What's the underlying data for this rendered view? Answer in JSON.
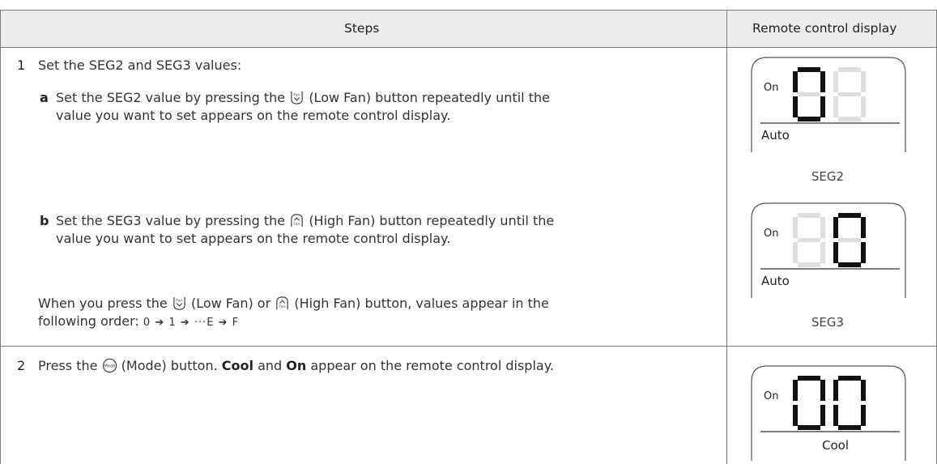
{
  "header": {
    "steps_label": "Steps",
    "display_label": "Remote control display"
  },
  "step1": {
    "number": "1",
    "title": "Set the SEG2 and SEG3 values:",
    "a": {
      "letter": "a",
      "line1_pre": "Set the SEG2 value by pressing the",
      "line1_post": "(Low Fan) button repeatedly until the",
      "line2": "value you want to set appears on the remote control display."
    },
    "b": {
      "letter": "b",
      "line1_pre": "Set the SEG3 value by pressing the",
      "line1_post": "(High Fan) button repeatedly until the",
      "line2": "value you want to set appears on the remote control display."
    },
    "note": {
      "line1_pre": "When you press the",
      "line1_mid": "(Low Fan) or",
      "line1_post": "(High Fan) button, values appear in the",
      "line2": "following order:",
      "sequence": [
        "0",
        "1",
        "E",
        "F"
      ],
      "arrow": "➔",
      "ellipsis": "···"
    },
    "display_seg2": {
      "on": "On",
      "mode": "Auto",
      "caption": "SEG2"
    },
    "display_seg3": {
      "on": "On",
      "mode": "Auto",
      "caption": "SEG3"
    }
  },
  "step2": {
    "number": "2",
    "text_pre": "Press the",
    "text_mid": "(Mode) button.",
    "cool": "Cool",
    "and": "and",
    "on": "On",
    "text_post": "appear on the remote control display.",
    "display": {
      "on": "On",
      "mode": "Cool"
    }
  },
  "icons": {
    "low_fan": "low-fan-icon",
    "high_fan": "high-fan-icon",
    "mode": "mode-icon",
    "fan_text": "Fan",
    "mode_text": "Mode"
  }
}
